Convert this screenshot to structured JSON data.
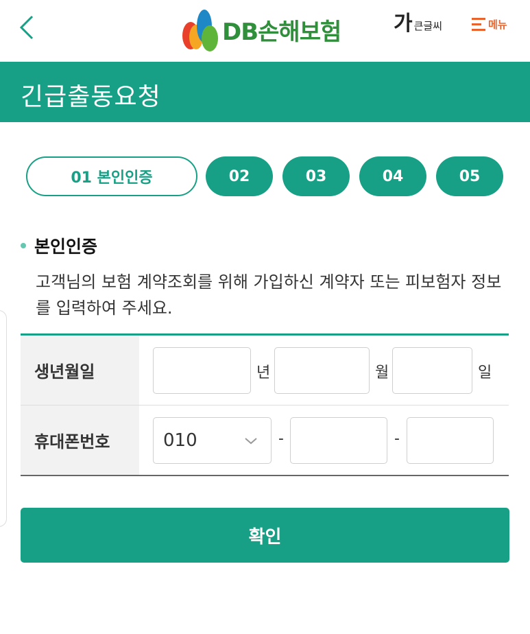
{
  "header": {
    "logo_text": "DB손해보험",
    "big_text_glyph": "가",
    "big_text_label": "큰글씨",
    "menu_label": "메뉴"
  },
  "title": "긴급출동요청",
  "steps": [
    {
      "label": "01 본인인증",
      "active": true
    },
    {
      "label": "02",
      "active": false
    },
    {
      "label": "03",
      "active": false
    },
    {
      "label": "04",
      "active": false
    },
    {
      "label": "05",
      "active": false
    }
  ],
  "section": {
    "title": "본인인증",
    "description": "고객님의 보험 계약조회를 위해 가입하신 계약자 또는 피보험자 정보를 입력하여 주세요."
  },
  "form": {
    "birth_label": "생년월일",
    "birth_units": {
      "year": "년",
      "month": "월",
      "day": "일"
    },
    "phone_label": "휴대폰번호",
    "phone_prefix_selected": "010",
    "phone_separator": "-"
  },
  "confirm_label": "확인",
  "colors": {
    "accent": "#17a085",
    "logo_green": "#2f8f3b",
    "menu_orange": "#e8642c"
  }
}
